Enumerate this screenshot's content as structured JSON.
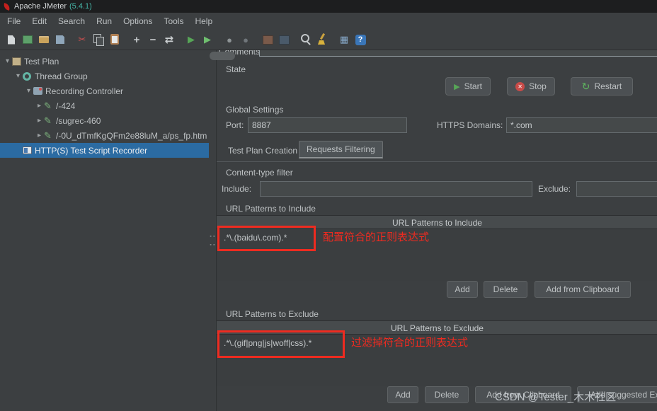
{
  "window": {
    "app_name": "Apache JMeter",
    "version": "(5.4.1)"
  },
  "menu_bar": {
    "items": [
      "File",
      "Edit",
      "Search",
      "Run",
      "Options",
      "Tools",
      "Help"
    ]
  },
  "toolbar": {
    "icons": [
      {
        "name": "new-file",
        "glyph": ""
      },
      {
        "name": "templates",
        "glyph": ""
      },
      {
        "name": "open-file",
        "glyph": ""
      },
      {
        "name": "save",
        "glyph": ""
      },
      {
        "name": "cut",
        "glyph": "✂"
      },
      {
        "name": "copy",
        "glyph": ""
      },
      {
        "name": "paste",
        "glyph": ""
      },
      {
        "name": "expand-all",
        "glyph": "+"
      },
      {
        "name": "collapse-all",
        "glyph": "−"
      },
      {
        "name": "toggle",
        "glyph": "⇄"
      },
      {
        "name": "start",
        "glyph": "▶"
      },
      {
        "name": "start-no-timers",
        "glyph": "▶"
      },
      {
        "name": "stop",
        "glyph": "●"
      },
      {
        "name": "shutdown",
        "glyph": "●"
      },
      {
        "name": "remote-start-all",
        "glyph": ""
      },
      {
        "name": "remote-shutdown-all",
        "glyph": ""
      },
      {
        "name": "search",
        "glyph": ""
      },
      {
        "name": "clear-all",
        "glyph": ""
      },
      {
        "name": "function-helper",
        "glyph": "▦"
      },
      {
        "name": "help",
        "glyph": "?"
      }
    ]
  },
  "tree": {
    "items": [
      {
        "chevron": "▾",
        "icon_glyph": "",
        "label": "Test Plan"
      },
      {
        "chevron": "▾",
        "icon_glyph": "",
        "label": "Thread Group"
      },
      {
        "chevron": "▾",
        "icon_glyph": "",
        "label": "Recording Controller"
      },
      {
        "chevron": "▸",
        "icon_glyph": "✎",
        "label": "/-424"
      },
      {
        "chevron": "▸",
        "icon_glyph": "✎",
        "label": "/sugrec-460"
      },
      {
        "chevron": "▸",
        "icon_glyph": "✎",
        "label": "/-0U_dTmfKgQFm2e88luM_a/ps_fp.htm"
      },
      {
        "chevron": "",
        "icon_glyph": "",
        "label": "HTTP(S) Test Script Recorder"
      }
    ]
  },
  "main": {
    "comments_label": "Comments:",
    "comments_value": "",
    "state_label": "State",
    "start_button": "Start",
    "start_glyph": "▶",
    "stop_button": "Stop",
    "stop_glyph": "✕",
    "restart_button": "Restart",
    "restart_glyph": "↻",
    "global_settings_label": "Global Settings",
    "port_label": "Port:",
    "port_value": "8887",
    "https_domains_label": "HTTPS Domains:",
    "https_domains_value": "*.com",
    "tabs": {
      "test_plan_creation": "Test Plan Creation",
      "requests_filtering": "Requests Filtering",
      "selected": "Requests Filtering"
    },
    "content_type_filter_label": "Content-type filter",
    "include_label": "Include:",
    "include_value": "",
    "exclude_label": "Exclude:",
    "exclude_value": "",
    "url_include": {
      "section_label": "URL Patterns to Include",
      "table_header": "URL Patterns to Include",
      "row_0": ".*\\.(baidu\\.com).*",
      "annotation": "配置符合的正则表达式",
      "add": "Add",
      "delete": "Delete",
      "add_from_clipboard": "Add from Clipboard"
    },
    "url_exclude": {
      "section_label": "URL Patterns to Exclude",
      "table_header": "URL Patterns to Exclude",
      "row_0": ".*\\.(gif|png|js|woff|css).*",
      "annotation": "过滤掉符合的正则表达式",
      "add": "Add",
      "delete": "Delete",
      "add_from_clipboard": "Add from Clipboard",
      "add_suggested": "Add suggested Excludes"
    },
    "watermark": "CSDN @Tester_木木社区"
  },
  "colors": {
    "annotation_red": "#ee2b20",
    "tree_selection_blue": "#2b6ba2",
    "start_green": "#57a657",
    "title_version_teal": "#45b3a5",
    "panel_background": "#3c3f41"
  }
}
